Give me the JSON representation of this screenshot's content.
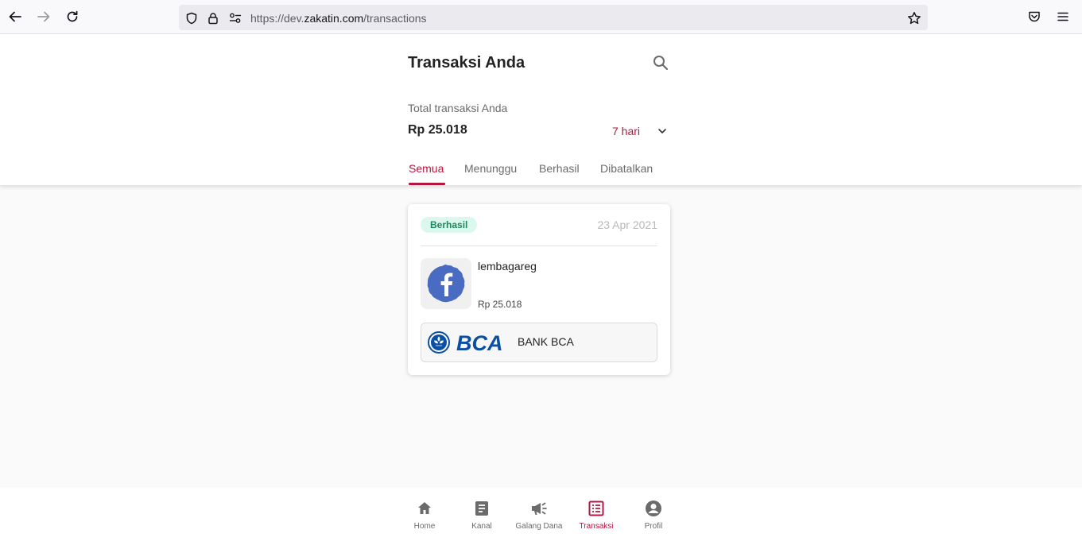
{
  "browser": {
    "url_prefix": "https://dev.",
    "url_domain": "zakatin.com",
    "url_path": "/transactions"
  },
  "header": {
    "title": "Transaksi Anda",
    "total_label": "Total transaksi Anda",
    "total_amount": "Rp 25.018",
    "period": "7 hari"
  },
  "tabs": [
    {
      "label": "Semua",
      "active": true
    },
    {
      "label": "Menunggu",
      "active": false
    },
    {
      "label": "Berhasil",
      "active": false
    },
    {
      "label": "Dibatalkan",
      "active": false
    }
  ],
  "transactions": [
    {
      "status": "Berhasil",
      "date": "23 Apr 2021",
      "channel_name": "lembagareg",
      "amount": "Rp 25.018",
      "bank_name": "BANK BCA",
      "bank_logo_text": "BCA",
      "channel_icon": "facebook-icon"
    }
  ],
  "bottom_nav": [
    {
      "label": "Home",
      "icon": "home-icon",
      "active": false
    },
    {
      "label": "Kanal",
      "icon": "document-icon",
      "active": false
    },
    {
      "label": "Galang Dana",
      "icon": "megaphone-icon",
      "active": false
    },
    {
      "label": "Transaksi",
      "icon": "list-icon",
      "active": true
    },
    {
      "label": "Profil",
      "icon": "account-icon",
      "active": false
    }
  ],
  "colors": {
    "primary": "#b3173f",
    "success_bg": "#dcf8ee",
    "success_text": "#1a8a5c"
  }
}
